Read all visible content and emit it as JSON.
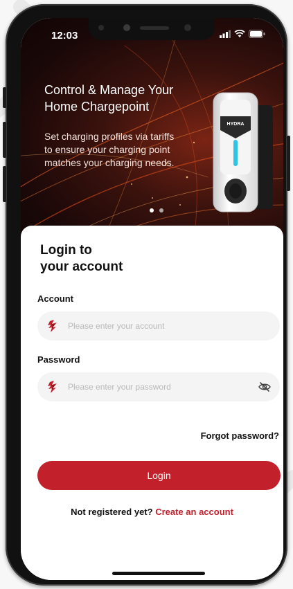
{
  "status_bar": {
    "time": "12:03"
  },
  "hero": {
    "title": "Control & Manage Your Home Chargepoint",
    "description": "Set charging profiles via tariffs to ensure your charging point matches your charging needs.",
    "charger_brand": "HYDRA",
    "carousel_pages": 2,
    "carousel_active_index": 0
  },
  "login": {
    "title_line1": "Login to",
    "title_line2": "your account",
    "account_label": "Account",
    "account_placeholder": "Please enter your account",
    "account_value": "",
    "password_label": "Password",
    "password_placeholder": "Please enter your password",
    "password_value": "",
    "forgot_label": "Forgot password?",
    "login_button": "Login",
    "register_prompt": "Not registered yet?",
    "register_link": "Create an account"
  },
  "icons": {
    "field_icon": "brand-logo-icon",
    "password_toggle": "eye-off-icon",
    "signal": "signal-icon",
    "wifi": "wifi-icon",
    "battery": "battery-icon"
  },
  "colors": {
    "accent": "#c2202a",
    "field_background": "#f4f4f4",
    "hero_background": "#3a120d"
  }
}
